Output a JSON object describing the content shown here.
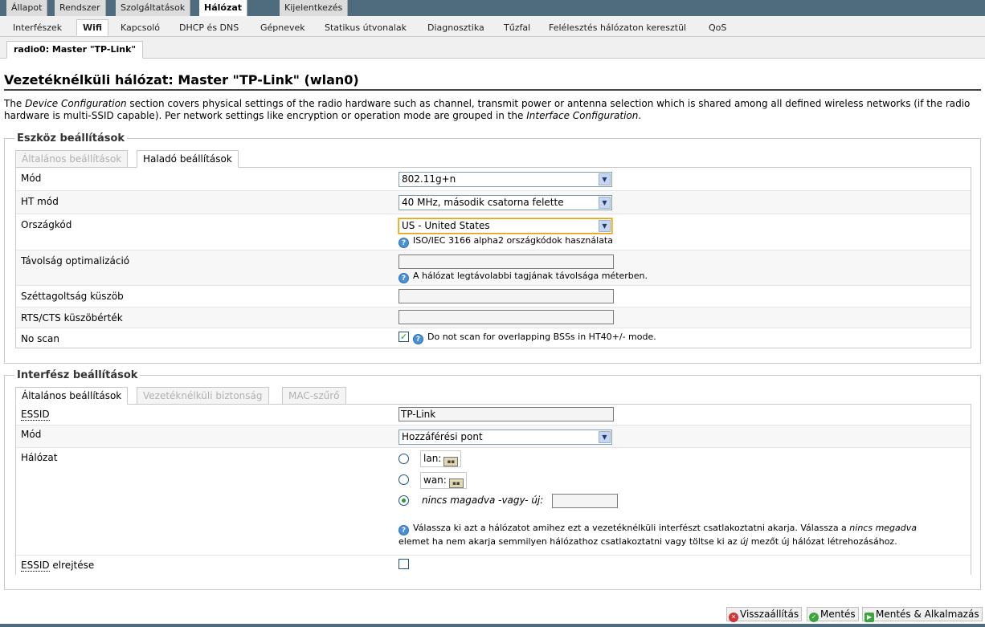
{
  "main_tabs": [
    "Állapot",
    "Rendszer",
    "Szolgáltatások",
    "Hálózat",
    "Kijelentkezés"
  ],
  "sub_tabs": [
    "Interfészek",
    "Wifi",
    "Kapcsoló",
    "DHCP és DNS",
    "Gépnevek",
    "Statikus útvonalak",
    "Diagnosztika",
    "Tűzfal",
    "Felélesztés hálózaton keresztül",
    "QoS"
  ],
  "radio_tab": "radio0: Master \"TP-Link\"",
  "page_title": "Vezetéknélküli hálózat: Master \"TP-Link\" (wlan0)",
  "description": {
    "p1": "The ",
    "em1": "Device Configuration",
    "p2": " section covers physical settings of the radio hardware such as channel, transmit power or antenna selection which is shared among all defined wireless networks (if the radio hardware is multi-SSID capable). Per network settings like encryption or operation mode are grouped in the ",
    "em2": "Interface Configuration",
    "p3": "."
  },
  "device": {
    "legend": "Eszköz beállítások",
    "tabs": [
      "Általános beállítások",
      "Haladó beállítások"
    ],
    "mode_label": "Mód",
    "mode_value": "802.11g+n",
    "ht_label": "HT mód",
    "ht_value": "40 MHz, második csatorna felette",
    "country_label": "Országkód",
    "country_value": "US - United States",
    "country_hint": "ISO/IEC 3166 alpha2 országkódok használata",
    "distance_label": "Távolság optimalizáció",
    "distance_value": "",
    "distance_hint": "A hálózat legtávolabbi tagjának távolsága méterben.",
    "frag_label": "Széttagoltság küszöb",
    "frag_value": "",
    "rts_label": "RTS/CTS küszöbérték",
    "rts_value": "",
    "noscan_label": "No scan",
    "noscan_checked": true,
    "noscan_hint": "Do not scan for overlapping BSSs in HT40+/- mode."
  },
  "iface": {
    "legend": "Interfész beállítások",
    "tabs": [
      "Általános beállítások",
      "Vezetéknélküli biztonság",
      "MAC-szűrő"
    ],
    "essid_label": "ESSID",
    "essid_value": "TP-Link",
    "mode_label": "Mód",
    "mode_value": "Hozzáférési pont",
    "network_label": "Hálózat",
    "networks": [
      "lan:",
      "wan:"
    ],
    "network_new_label": "nincs magadva -vagy- új:",
    "network_new_value": "",
    "network_hint_1": "Válassza ki azt a hálózatot amihez ezt a vezetéknélküli interfészt csatlakoztatni akarja. Válassza a ",
    "network_hint_em1": "nincs megadva",
    "network_hint_2": "elemet ha nem akarja semmilyen hálózathoz csatlakoztatni vagy töltse ki az ",
    "network_hint_em2": "új",
    "network_hint_3": " mezőt új hálózat létrehozásához.",
    "hide_label_a": "ESSID",
    "hide_label_b": " elrejtése",
    "hide_checked": false
  },
  "buttons": {
    "reset": "Visszaállítás",
    "save": "Mentés",
    "save_apply": "Mentés & Alkalmazás"
  },
  "colors": {
    "top_bar": "#4f6b7e",
    "focus": "#e5a000"
  }
}
